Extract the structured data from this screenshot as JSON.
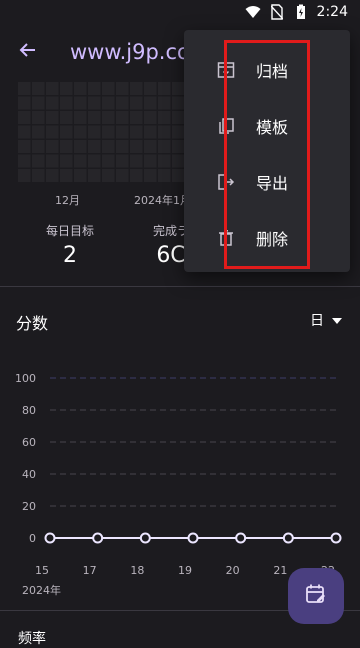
{
  "status_bar": {
    "time": "2:24"
  },
  "app_bar": {
    "title": "www.j9p.co"
  },
  "heatmap": {
    "month_labels": [
      "12月",
      "2024年1月"
    ]
  },
  "stats": [
    {
      "label": "每日目标",
      "value": "2"
    },
    {
      "label": "完成ラ",
      "value": "6C"
    }
  ],
  "score": {
    "title": "分数",
    "period": "日"
  },
  "chart_data": {
    "type": "line",
    "x": [
      "15",
      "17",
      "18",
      "19",
      "20",
      "21",
      "22"
    ],
    "x_year_label": "2024年",
    "y_ticks": [
      "0",
      "20",
      "40",
      "60",
      "80",
      "100"
    ],
    "ylim": [
      0,
      100
    ],
    "series": [
      {
        "values": [
          0,
          0,
          0,
          0,
          0,
          0,
          0
        ]
      }
    ],
    "grid": true
  },
  "menu": {
    "items": [
      {
        "label": "归档",
        "icon": "archive-icon"
      },
      {
        "label": "模板",
        "icon": "copy-icon"
      },
      {
        "label": "导出",
        "icon": "export-icon"
      },
      {
        "label": "删除",
        "icon": "delete-icon"
      }
    ]
  },
  "next_section": {
    "title": "频率"
  },
  "colors": {
    "accent": "#d0bcff",
    "line": "#ece6ff",
    "highlight": "#e11b1b"
  }
}
